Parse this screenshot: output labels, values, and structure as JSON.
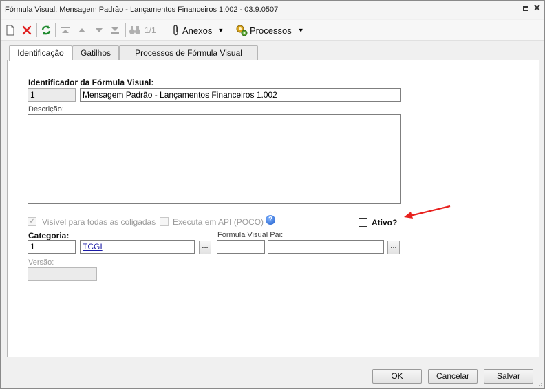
{
  "window": {
    "title": "Fórmula Visual: Mensagem Padrão - Lançamentos Financeiros 1.002 - 03.9.0507"
  },
  "toolbar": {
    "page_indicator": "1/1",
    "attachments_label": "Anexos",
    "processes_label": "Processos"
  },
  "tabs": [
    {
      "label": "Identificação",
      "active": true
    },
    {
      "label": "Gatilhos",
      "active": false
    },
    {
      "label": "Processos de Fórmula Visual",
      "active": false
    }
  ],
  "form": {
    "identifier_label": "Identificador da Fórmula Visual:",
    "identifier_code": "1",
    "identifier_name": "Mensagem Padrão - Lançamentos Financeiros 1.002",
    "description_label": "Descrição:",
    "description_value": "",
    "visible_all_label": "Visível para todas as coligadas",
    "visible_all_checked": true,
    "execute_api_label": "Executa em API (POCO)",
    "execute_api_checked": false,
    "active_label": "Ativo?",
    "active_checked": false,
    "category_label": "Categoria:",
    "category_code": "1",
    "category_name": "TCGI",
    "parent_formula_label": "Fórmula Visual Pai:",
    "parent_formula_code": "",
    "parent_formula_name": "",
    "version_label": "Versão:",
    "version_value": "",
    "ellipsis": "..."
  },
  "footer": {
    "ok_label": "OK",
    "cancel_label": "Cancelar",
    "save_label": "Salvar"
  },
  "colors": {
    "annotation_arrow": "#e8201d",
    "link": "#1a1aa6",
    "delete_icon": "#e02020",
    "refresh_icon": "#1f8a2e"
  }
}
